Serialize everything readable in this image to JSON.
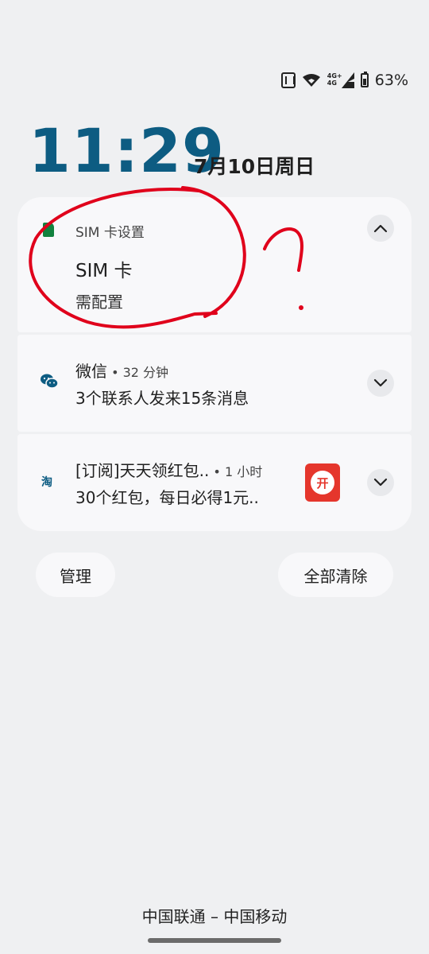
{
  "status_bar": {
    "network_label": "4G+\n4G",
    "battery_percent": "63%",
    "battery_level": 0.63,
    "icons": [
      "hd-icon",
      "wifi-icon",
      "signal-icon",
      "battery-icon"
    ]
  },
  "lockscreen": {
    "time": "11:29",
    "date": "7月10日周日"
  },
  "notifications": [
    {
      "app_name": "SIM 卡设置",
      "title": "SIM 卡",
      "body": "需配置",
      "icon": "sim-card-icon",
      "expanded": true
    },
    {
      "app_name": "微信",
      "time": " • 32 分钟",
      "body": "3个联系人发来15条消息",
      "icon": "wechat-icon",
      "expanded": false
    },
    {
      "app_name": "[订阅]天天领红包..",
      "time": " • 1 小时",
      "body": "30个红包，每日必得1元..",
      "icon": "taobao-icon",
      "icon_glyph": "淘",
      "thumbnail_label": "开",
      "expanded": false
    }
  ],
  "actions": {
    "manage_label": "管理",
    "clear_all_label": "全部清除"
  },
  "carrier": "中国联通 – 中国移动",
  "colors": {
    "clock": "#0d5c82",
    "annotation": "#e0001b",
    "sim_icon": "#12823e",
    "thumbnail": "#e5362c"
  }
}
